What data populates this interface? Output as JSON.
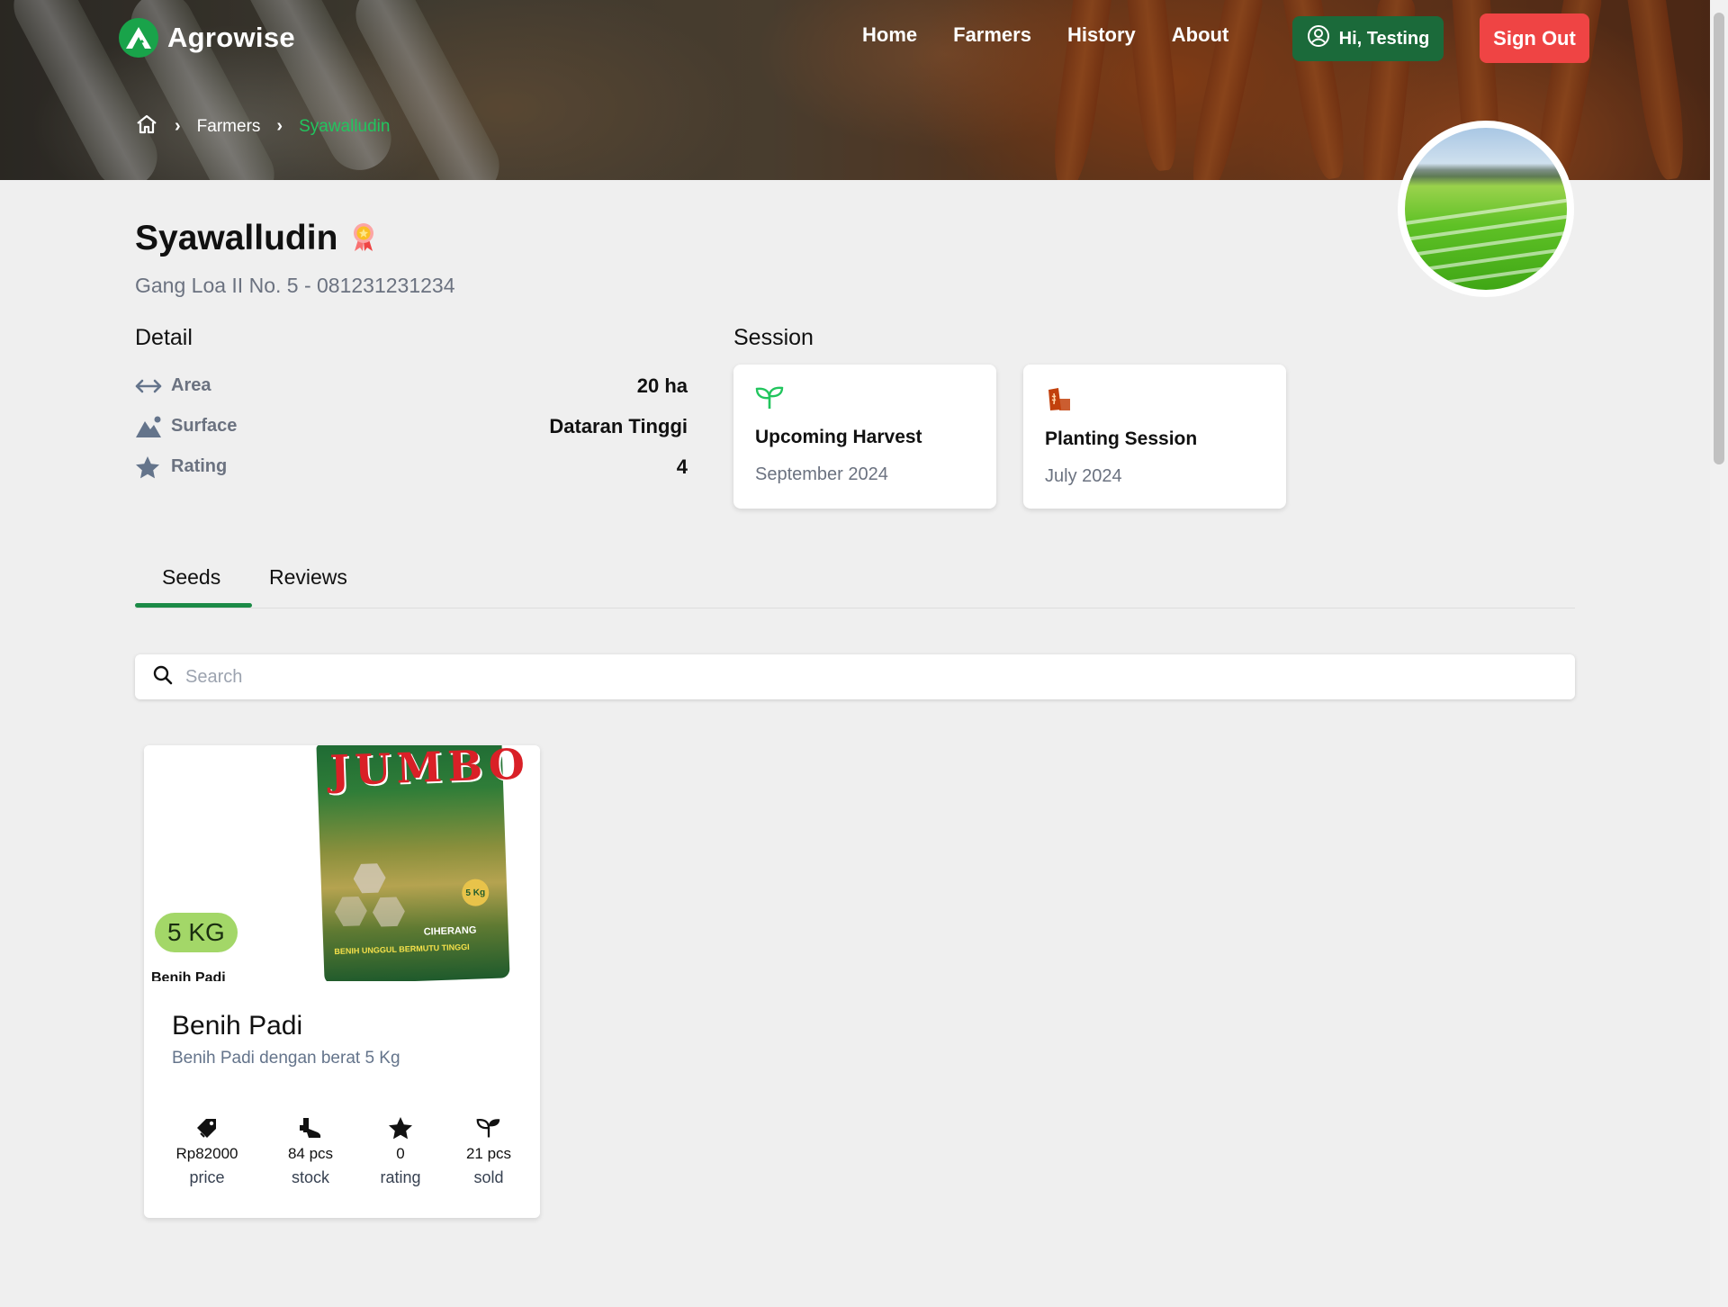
{
  "brand": {
    "name": "Agrowise"
  },
  "nav": {
    "links": [
      "Home",
      "Farmers",
      "History",
      "About"
    ],
    "user_label": "Hi, Testing",
    "signout_label": "Sign Out"
  },
  "breadcrumb": {
    "items": [
      "Farmers",
      "Syawalludin"
    ]
  },
  "farmer": {
    "name": "Syawalludin",
    "address": "Gang Loa II No. 5 - 081231231234"
  },
  "detail": {
    "title": "Detail",
    "rows": [
      {
        "label": "Area",
        "value": "20 ha",
        "icon": "arrows-horizontal-icon"
      },
      {
        "label": "Surface",
        "value": "Dataran Tinggi",
        "icon": "mountain-icon"
      },
      {
        "label": "Rating",
        "value": "4",
        "icon": "star-icon"
      }
    ]
  },
  "session": {
    "title": "Session",
    "cards": [
      {
        "title": "Upcoming Harvest",
        "date": "September 2024",
        "icon": "sprout-icon",
        "color": "#22c55e"
      },
      {
        "title": "Planting Session",
        "date": "July 2024",
        "icon": "seed-bag-icon",
        "color": "#c2410c"
      }
    ]
  },
  "tabs": {
    "items": [
      "Seeds",
      "Reviews"
    ],
    "active": "Seeds"
  },
  "search": {
    "placeholder": "Search"
  },
  "products": [
    {
      "name": "Benih Padi",
      "description": "Benih Padi dengan berat 5 Kg",
      "weight_badge": "5 KG",
      "image_caption": "Benih Padi",
      "image_text": {
        "brand": "JUMBO",
        "badge": "5 Kg",
        "caption": "CIHERANG",
        "band": "BENIH UNGGUL BERMUTU TINGGI"
      },
      "stats": [
        {
          "value": "Rp82000",
          "label": "price",
          "icon": "price-tag-icon"
        },
        {
          "value": "84 pcs",
          "label": "stock",
          "icon": "boots-icon"
        },
        {
          "value": "0",
          "label": "rating",
          "icon": "star-icon"
        },
        {
          "value": "21 pcs",
          "label": "sold",
          "icon": "sprout-icon"
        }
      ]
    }
  ],
  "colors": {
    "accent_green": "#1b6a3a",
    "active_green": "#22c55e",
    "signout_red": "#ef4444",
    "weight_pill": "#a3d768"
  }
}
